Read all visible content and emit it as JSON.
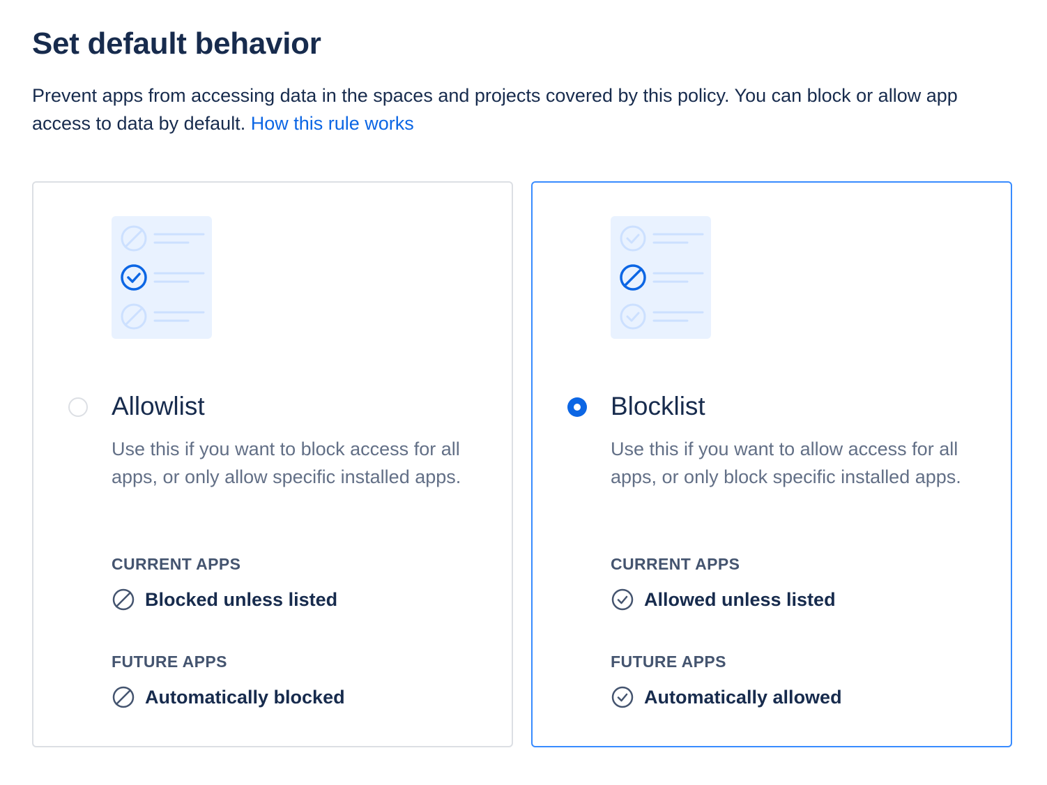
{
  "page": {
    "title": "Set default behavior",
    "description": "Prevent apps from accessing data in the spaces and projects covered by this policy. You can block or allow app access to data by default.",
    "help_link": "How this rule works"
  },
  "colors": {
    "accent": "#0C66E4",
    "selected_border": "#388BFF",
    "text_primary": "#172B4D",
    "text_subtle": "#626F86",
    "card_border": "#DCDFE4",
    "illustration_bg": "#E9F2FF"
  },
  "options": [
    {
      "id": "allowlist",
      "title": "Allowlist",
      "selected": false,
      "description": "Use this if you want to block access for all apps, or only allow specific installed apps.",
      "current_label": "CURRENT APPS",
      "current_icon": "blocked-icon",
      "current_value": "Blocked unless listed",
      "future_label": "FUTURE APPS",
      "future_icon": "blocked-icon",
      "future_value": "Automatically blocked"
    },
    {
      "id": "blocklist",
      "title": "Blocklist",
      "selected": true,
      "description": "Use this if you want to allow access for all apps, or only block specific installed apps.",
      "current_label": "CURRENT APPS",
      "current_icon": "check-circle-icon",
      "current_value": "Allowed unless listed",
      "future_label": "FUTURE APPS",
      "future_icon": "check-circle-icon",
      "future_value": "Automatically allowed"
    }
  ]
}
